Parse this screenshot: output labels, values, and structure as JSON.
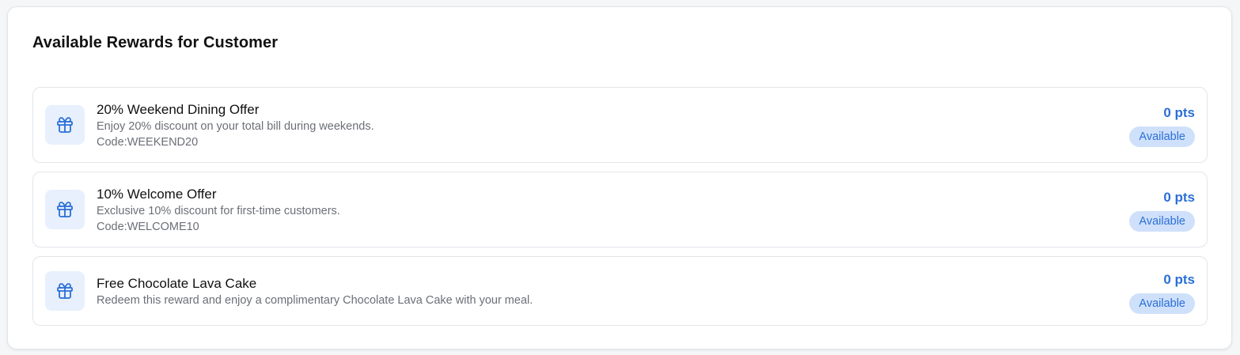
{
  "panel": {
    "title": "Available Rewards for Customer"
  },
  "rewards": [
    {
      "icon": "gift-icon",
      "name": "20% Weekend Dining Offer",
      "description": "Enjoy 20% discount on your total bill during weekends.",
      "code": "Code:WEEKEND20",
      "points": "0 pts",
      "status": "Available"
    },
    {
      "icon": "gift-icon",
      "name": "10% Welcome Offer",
      "description": "Exclusive 10% discount for first-time customers.",
      "code": "Code:WELCOME10",
      "points": "0 pts",
      "status": "Available"
    },
    {
      "icon": "gift-icon",
      "name": "Free Chocolate Lava Cake",
      "description": "Redeem this reward and enjoy a complimentary Chocolate Lava Cake with your meal.",
      "points": "0 pts",
      "status": "Available"
    }
  ],
  "colors": {
    "accent": "#2a6fd6",
    "badge_bg": "#cfe0fb",
    "icon_bg": "#e8f0fd"
  }
}
